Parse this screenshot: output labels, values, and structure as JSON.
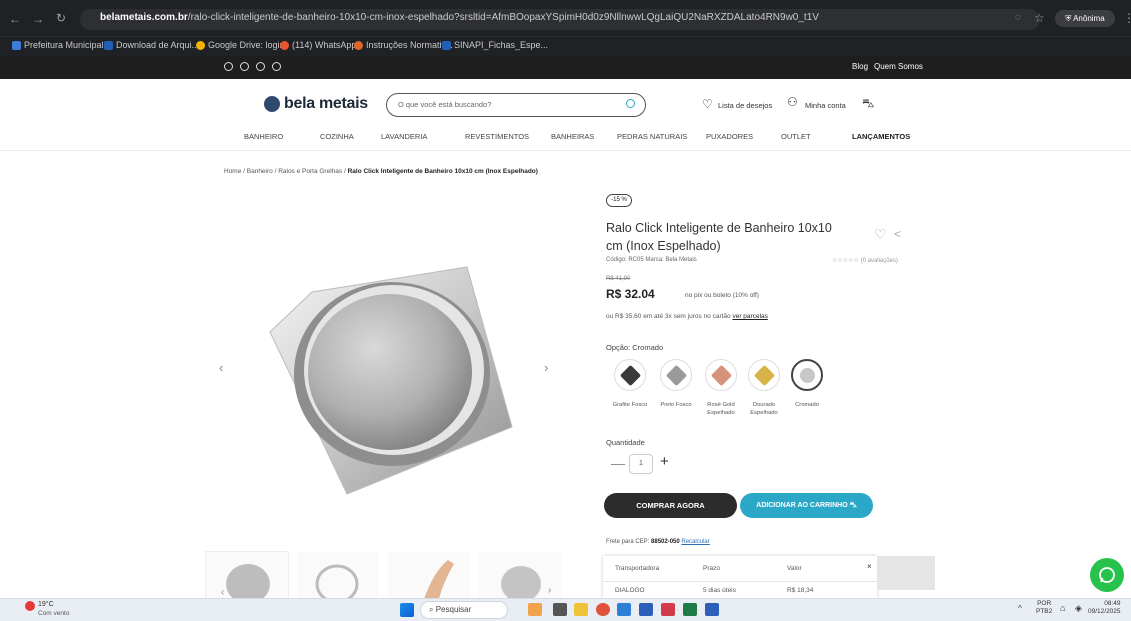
{
  "browser": {
    "url_domain": "belametais.com.br",
    "url_path": "/ralo-click-inteligente-de-banheiro-10x10-cm-inox-espelhado?srsltid=AfmBOopaxYSpimH0d0z9NllnwwLQgLaiQU2NaRXZDALato4RN9w0_t1V",
    "profile": "Anônima",
    "bookmarks": [
      "Prefeitura Municipal...",
      "Download de Arqui...",
      "Google Drive: login",
      "(114) WhatsApp",
      "Instruções Normativ...",
      "SINAPI_Fichas_Espe..."
    ]
  },
  "site_topbar": {
    "blog": "Blog",
    "about": "Quem Somos"
  },
  "header": {
    "logo": "bela metais",
    "search_placeholder": "O que você está buscando?",
    "wishlist": "Lista de desejos",
    "account": "Minha conta"
  },
  "nav": [
    "BANHEIRO",
    "COZINHA",
    "LAVANDERIA",
    "REVESTIMENTOS",
    "BANHEIRAS",
    "PEDRAS NATURAIS",
    "PUXADORES",
    "OUTLET",
    "LANÇAMENTOS"
  ],
  "breadcrumb": {
    "trail": "Home  /  Banheiro  /  Ralos e Porta Grelhas  /",
    "current": "Ralo Click Inteligente de Banheiro 10x10 cm (Inox Espelhado)"
  },
  "product": {
    "discount_badge": "-15 %",
    "title": "Ralo Click Inteligente de Banheiro 10x10 cm (Inox Espelhado)",
    "meta": "Código: RC05   Marca: Bela Metais",
    "reviews": "(0 avaliações)",
    "old_price": "R$ 41,90",
    "price": "R$ 32.04",
    "pix_note": "no pix ou boleto (10% off)",
    "installments": "ou R$ 35,60 em até 3x sem juros no cartão",
    "installments_link": "ver parcelas",
    "option_label": "Opção: Cromado",
    "options": [
      {
        "name": "Grafite Fosco",
        "color": "#3a3a3a"
      },
      {
        "name": "Preto Fosco",
        "color": "#9a9a9a"
      },
      {
        "name": "Rosé Gold Espelhado",
        "color": "#d4937a"
      },
      {
        "name": "Dourado Espelhado",
        "color": "#d8b448"
      },
      {
        "name": "Cromado",
        "color": "#c7c7c7"
      }
    ],
    "quantity_label": "Quantidade",
    "quantity": "1",
    "buy_now": "COMPRAR AGORA",
    "add_to_cart": "ADICIONAR AO CARRINHO",
    "shipping_text": "Frete para CEP:",
    "shipping_cep": "88502-050",
    "shipping_recalc": "Recalcular",
    "shipping_table": {
      "headers": [
        "Transportadora",
        "Prazo",
        "Valor"
      ],
      "row": [
        "DIALOGO",
        "5 dias úteis",
        "R$ 18,34"
      ],
      "close": "×"
    }
  },
  "taskbar": {
    "weather_temp": "19°C",
    "weather_desc": "Com vento",
    "search": "Pesquisar",
    "lang": "POR",
    "layout": "PTB2",
    "time": "08:49",
    "date": "09/12/2025"
  },
  "colors": {
    "accent": "#2ba8c7",
    "dark": "#2c2c2c",
    "whatsapp": "#27c24c"
  }
}
